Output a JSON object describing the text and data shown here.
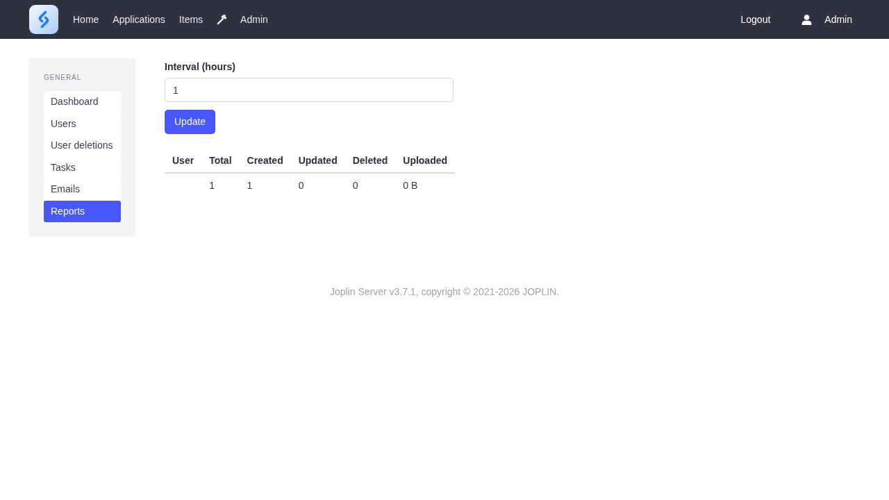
{
  "navbar": {
    "links": [
      {
        "kind": "text",
        "label": "Home"
      },
      {
        "kind": "text",
        "label": "Applications"
      },
      {
        "kind": "text",
        "label": "Items"
      },
      {
        "kind": "admin",
        "label": "Admin"
      }
    ],
    "logout": "Logout",
    "user": "Admin"
  },
  "sidebar": {
    "heading": "GENERAL",
    "items": [
      {
        "label": "Dashboard",
        "selected": false
      },
      {
        "label": "Users",
        "selected": false
      },
      {
        "label": "User deletions",
        "selected": false
      },
      {
        "label": "Tasks",
        "selected": false
      },
      {
        "label": "Emails",
        "selected": false
      },
      {
        "label": "Reports",
        "selected": true
      }
    ]
  },
  "form": {
    "label": "Interval (hours)",
    "value": "1",
    "button": "Update"
  },
  "table": {
    "columns": [
      "User",
      "Total",
      "Created",
      "Updated",
      "Deleted",
      "Uploaded"
    ],
    "rows": [
      [
        null,
        "1",
        "1",
        "0",
        "0",
        "0 B"
      ]
    ]
  },
  "footer": "Joplin Server v3.7.1, copyright © 2021-2026 JOPLIN."
}
